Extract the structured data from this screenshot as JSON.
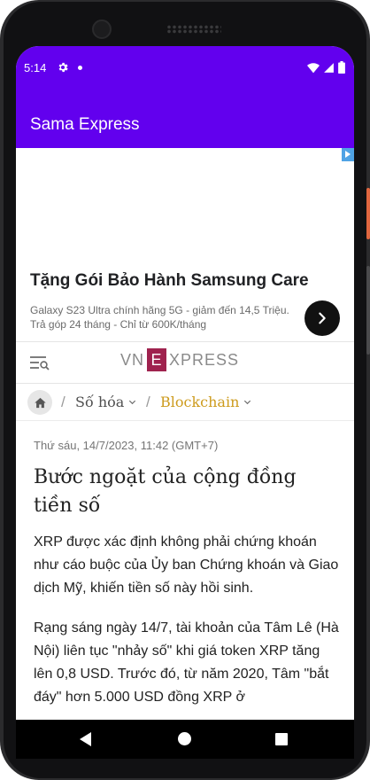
{
  "status_bar": {
    "time": "5:14"
  },
  "app_bar": {
    "title": "Sama Express"
  },
  "ad": {
    "headline": "Tặng Gói Bảo Hành Samsung Care",
    "body": "Galaxy S23 Ultra chính hãng 5G - giảm đến 14,5 Triệu. Trả góp 24 tháng - Chỉ từ 600K/tháng"
  },
  "site": {
    "logo_left": "VN",
    "logo_box": "E",
    "logo_right": "XPRESS"
  },
  "breadcrumb": {
    "category": "Số hóa",
    "subcategory": "Blockchain",
    "separator": "/"
  },
  "article": {
    "dateline": "Thứ sáu, 14/7/2023, 11:42 (GMT+7)",
    "title": "Bước ngoặt của cộng đồng tiền số",
    "lead": "XRP được xác định không phải chứng khoán như cáo buộc của Ủy ban Chứng khoán và Giao dịch Mỹ, khiến tiền số này hồi sinh.",
    "paragraph": "Rạng sáng ngày 14/7, tài khoản của Tâm Lê (Hà Nội) liên tục \"nhảy số\" khi giá token XRP tăng lên 0,8 USD. Trước đó, từ năm 2020, Tâm \"bắt đáy\" hơn 5.000 USD đồng XRP ở"
  },
  "colors": {
    "app_bar": "#6200ee",
    "brand_vnexpress": "#9f224e",
    "breadcrumb_active": "#cd9b1d"
  }
}
